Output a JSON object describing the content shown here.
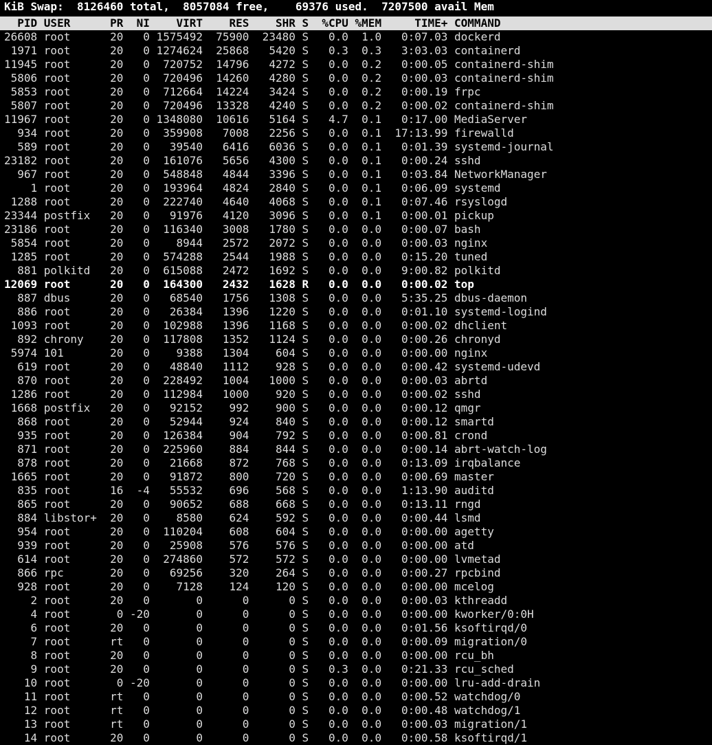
{
  "swap_line_fragment": "KiB Swap:  8126460 total,  8057084 free,    69376 used.  7207500 avail Mem",
  "columns": [
    "PID",
    "USER",
    "PR",
    "NI",
    "VIRT",
    "RES",
    "SHR",
    "S",
    "%CPU",
    "%MEM",
    "TIME+",
    "COMMAND"
  ],
  "processes": [
    {
      "pid": "26608",
      "user": "root",
      "pr": "20",
      "ni": "0",
      "virt": "1575492",
      "res": "75900",
      "shr": "23480",
      "s": "S",
      "cpu": "0.0",
      "mem": "1.0",
      "time": "0:07.03",
      "cmd": "dockerd",
      "bold": false
    },
    {
      "pid": "1971",
      "user": "root",
      "pr": "20",
      "ni": "0",
      "virt": "1274624",
      "res": "25868",
      "shr": "5420",
      "s": "S",
      "cpu": "0.3",
      "mem": "0.3",
      "time": "3:03.03",
      "cmd": "containerd",
      "bold": false
    },
    {
      "pid": "11945",
      "user": "root",
      "pr": "20",
      "ni": "0",
      "virt": "720752",
      "res": "14796",
      "shr": "4272",
      "s": "S",
      "cpu": "0.0",
      "mem": "0.2",
      "time": "0:00.05",
      "cmd": "containerd-shim",
      "bold": false
    },
    {
      "pid": "5806",
      "user": "root",
      "pr": "20",
      "ni": "0",
      "virt": "720496",
      "res": "14260",
      "shr": "4280",
      "s": "S",
      "cpu": "0.0",
      "mem": "0.2",
      "time": "0:00.03",
      "cmd": "containerd-shim",
      "bold": false
    },
    {
      "pid": "5853",
      "user": "root",
      "pr": "20",
      "ni": "0",
      "virt": "712664",
      "res": "14224",
      "shr": "3424",
      "s": "S",
      "cpu": "0.0",
      "mem": "0.2",
      "time": "0:00.19",
      "cmd": "frpc",
      "bold": false
    },
    {
      "pid": "5807",
      "user": "root",
      "pr": "20",
      "ni": "0",
      "virt": "720496",
      "res": "13328",
      "shr": "4240",
      "s": "S",
      "cpu": "0.0",
      "mem": "0.2",
      "time": "0:00.02",
      "cmd": "containerd-shim",
      "bold": false
    },
    {
      "pid": "11967",
      "user": "root",
      "pr": "20",
      "ni": "0",
      "virt": "1348080",
      "res": "10616",
      "shr": "5164",
      "s": "S",
      "cpu": "4.7",
      "mem": "0.1",
      "time": "0:17.00",
      "cmd": "MediaServer",
      "bold": false
    },
    {
      "pid": "934",
      "user": "root",
      "pr": "20",
      "ni": "0",
      "virt": "359908",
      "res": "7008",
      "shr": "2256",
      "s": "S",
      "cpu": "0.0",
      "mem": "0.1",
      "time": "17:13.99",
      "cmd": "firewalld",
      "bold": false
    },
    {
      "pid": "589",
      "user": "root",
      "pr": "20",
      "ni": "0",
      "virt": "39540",
      "res": "6416",
      "shr": "6036",
      "s": "S",
      "cpu": "0.0",
      "mem": "0.1",
      "time": "0:01.39",
      "cmd": "systemd-journal",
      "bold": false
    },
    {
      "pid": "23182",
      "user": "root",
      "pr": "20",
      "ni": "0",
      "virt": "161076",
      "res": "5656",
      "shr": "4300",
      "s": "S",
      "cpu": "0.0",
      "mem": "0.1",
      "time": "0:00.24",
      "cmd": "sshd",
      "bold": false
    },
    {
      "pid": "967",
      "user": "root",
      "pr": "20",
      "ni": "0",
      "virt": "548848",
      "res": "4844",
      "shr": "3396",
      "s": "S",
      "cpu": "0.0",
      "mem": "0.1",
      "time": "0:03.84",
      "cmd": "NetworkManager",
      "bold": false
    },
    {
      "pid": "1",
      "user": "root",
      "pr": "20",
      "ni": "0",
      "virt": "193964",
      "res": "4824",
      "shr": "2840",
      "s": "S",
      "cpu": "0.0",
      "mem": "0.1",
      "time": "0:06.09",
      "cmd": "systemd",
      "bold": false
    },
    {
      "pid": "1288",
      "user": "root",
      "pr": "20",
      "ni": "0",
      "virt": "222740",
      "res": "4640",
      "shr": "4068",
      "s": "S",
      "cpu": "0.0",
      "mem": "0.1",
      "time": "0:07.46",
      "cmd": "rsyslogd",
      "bold": false
    },
    {
      "pid": "23344",
      "user": "postfix",
      "pr": "20",
      "ni": "0",
      "virt": "91976",
      "res": "4120",
      "shr": "3096",
      "s": "S",
      "cpu": "0.0",
      "mem": "0.1",
      "time": "0:00.01",
      "cmd": "pickup",
      "bold": false
    },
    {
      "pid": "23186",
      "user": "root",
      "pr": "20",
      "ni": "0",
      "virt": "116340",
      "res": "3008",
      "shr": "1780",
      "s": "S",
      "cpu": "0.0",
      "mem": "0.0",
      "time": "0:00.07",
      "cmd": "bash",
      "bold": false
    },
    {
      "pid": "5854",
      "user": "root",
      "pr": "20",
      "ni": "0",
      "virt": "8944",
      "res": "2572",
      "shr": "2072",
      "s": "S",
      "cpu": "0.0",
      "mem": "0.0",
      "time": "0:00.03",
      "cmd": "nginx",
      "bold": false
    },
    {
      "pid": "1285",
      "user": "root",
      "pr": "20",
      "ni": "0",
      "virt": "574288",
      "res": "2544",
      "shr": "1988",
      "s": "S",
      "cpu": "0.0",
      "mem": "0.0",
      "time": "0:15.20",
      "cmd": "tuned",
      "bold": false
    },
    {
      "pid": "881",
      "user": "polkitd",
      "pr": "20",
      "ni": "0",
      "virt": "615088",
      "res": "2472",
      "shr": "1692",
      "s": "S",
      "cpu": "0.0",
      "mem": "0.0",
      "time": "9:00.82",
      "cmd": "polkitd",
      "bold": false
    },
    {
      "pid": "12069",
      "user": "root",
      "pr": "20",
      "ni": "0",
      "virt": "164300",
      "res": "2432",
      "shr": "1628",
      "s": "R",
      "cpu": "0.0",
      "mem": "0.0",
      "time": "0:00.02",
      "cmd": "top",
      "bold": true
    },
    {
      "pid": "887",
      "user": "dbus",
      "pr": "20",
      "ni": "0",
      "virt": "68540",
      "res": "1756",
      "shr": "1308",
      "s": "S",
      "cpu": "0.0",
      "mem": "0.0",
      "time": "5:35.25",
      "cmd": "dbus-daemon",
      "bold": false
    },
    {
      "pid": "886",
      "user": "root",
      "pr": "20",
      "ni": "0",
      "virt": "26384",
      "res": "1396",
      "shr": "1220",
      "s": "S",
      "cpu": "0.0",
      "mem": "0.0",
      "time": "0:01.10",
      "cmd": "systemd-logind",
      "bold": false
    },
    {
      "pid": "1093",
      "user": "root",
      "pr": "20",
      "ni": "0",
      "virt": "102988",
      "res": "1396",
      "shr": "1168",
      "s": "S",
      "cpu": "0.0",
      "mem": "0.0",
      "time": "0:00.02",
      "cmd": "dhclient",
      "bold": false
    },
    {
      "pid": "892",
      "user": "chrony",
      "pr": "20",
      "ni": "0",
      "virt": "117808",
      "res": "1352",
      "shr": "1124",
      "s": "S",
      "cpu": "0.0",
      "mem": "0.0",
      "time": "0:00.26",
      "cmd": "chronyd",
      "bold": false
    },
    {
      "pid": "5974",
      "user": "101",
      "pr": "20",
      "ni": "0",
      "virt": "9388",
      "res": "1304",
      "shr": "604",
      "s": "S",
      "cpu": "0.0",
      "mem": "0.0",
      "time": "0:00.00",
      "cmd": "nginx",
      "bold": false
    },
    {
      "pid": "619",
      "user": "root",
      "pr": "20",
      "ni": "0",
      "virt": "48840",
      "res": "1112",
      "shr": "928",
      "s": "S",
      "cpu": "0.0",
      "mem": "0.0",
      "time": "0:00.42",
      "cmd": "systemd-udevd",
      "bold": false
    },
    {
      "pid": "870",
      "user": "root",
      "pr": "20",
      "ni": "0",
      "virt": "228492",
      "res": "1004",
      "shr": "1000",
      "s": "S",
      "cpu": "0.0",
      "mem": "0.0",
      "time": "0:00.03",
      "cmd": "abrtd",
      "bold": false
    },
    {
      "pid": "1286",
      "user": "root",
      "pr": "20",
      "ni": "0",
      "virt": "112984",
      "res": "1000",
      "shr": "920",
      "s": "S",
      "cpu": "0.0",
      "mem": "0.0",
      "time": "0:00.02",
      "cmd": "sshd",
      "bold": false
    },
    {
      "pid": "1668",
      "user": "postfix",
      "pr": "20",
      "ni": "0",
      "virt": "92152",
      "res": "992",
      "shr": "900",
      "s": "S",
      "cpu": "0.0",
      "mem": "0.0",
      "time": "0:00.12",
      "cmd": "qmgr",
      "bold": false
    },
    {
      "pid": "868",
      "user": "root",
      "pr": "20",
      "ni": "0",
      "virt": "52944",
      "res": "924",
      "shr": "840",
      "s": "S",
      "cpu": "0.0",
      "mem": "0.0",
      "time": "0:00.12",
      "cmd": "smartd",
      "bold": false
    },
    {
      "pid": "935",
      "user": "root",
      "pr": "20",
      "ni": "0",
      "virt": "126384",
      "res": "904",
      "shr": "792",
      "s": "S",
      "cpu": "0.0",
      "mem": "0.0",
      "time": "0:00.81",
      "cmd": "crond",
      "bold": false
    },
    {
      "pid": "871",
      "user": "root",
      "pr": "20",
      "ni": "0",
      "virt": "225960",
      "res": "884",
      "shr": "844",
      "s": "S",
      "cpu": "0.0",
      "mem": "0.0",
      "time": "0:00.14",
      "cmd": "abrt-watch-log",
      "bold": false
    },
    {
      "pid": "878",
      "user": "root",
      "pr": "20",
      "ni": "0",
      "virt": "21668",
      "res": "872",
      "shr": "768",
      "s": "S",
      "cpu": "0.0",
      "mem": "0.0",
      "time": "0:13.09",
      "cmd": "irqbalance",
      "bold": false
    },
    {
      "pid": "1665",
      "user": "root",
      "pr": "20",
      "ni": "0",
      "virt": "91872",
      "res": "800",
      "shr": "720",
      "s": "S",
      "cpu": "0.0",
      "mem": "0.0",
      "time": "0:00.69",
      "cmd": "master",
      "bold": false
    },
    {
      "pid": "835",
      "user": "root",
      "pr": "16",
      "ni": "-4",
      "virt": "55532",
      "res": "696",
      "shr": "568",
      "s": "S",
      "cpu": "0.0",
      "mem": "0.0",
      "time": "1:13.90",
      "cmd": "auditd",
      "bold": false
    },
    {
      "pid": "865",
      "user": "root",
      "pr": "20",
      "ni": "0",
      "virt": "90652",
      "res": "688",
      "shr": "668",
      "s": "S",
      "cpu": "0.0",
      "mem": "0.0",
      "time": "0:13.11",
      "cmd": "rngd",
      "bold": false
    },
    {
      "pid": "884",
      "user": "libstor+",
      "pr": "20",
      "ni": "0",
      "virt": "8580",
      "res": "624",
      "shr": "592",
      "s": "S",
      "cpu": "0.0",
      "mem": "0.0",
      "time": "0:00.44",
      "cmd": "lsmd",
      "bold": false
    },
    {
      "pid": "954",
      "user": "root",
      "pr": "20",
      "ni": "0",
      "virt": "110204",
      "res": "608",
      "shr": "604",
      "s": "S",
      "cpu": "0.0",
      "mem": "0.0",
      "time": "0:00.00",
      "cmd": "agetty",
      "bold": false
    },
    {
      "pid": "939",
      "user": "root",
      "pr": "20",
      "ni": "0",
      "virt": "25908",
      "res": "576",
      "shr": "576",
      "s": "S",
      "cpu": "0.0",
      "mem": "0.0",
      "time": "0:00.00",
      "cmd": "atd",
      "bold": false
    },
    {
      "pid": "614",
      "user": "root",
      "pr": "20",
      "ni": "0",
      "virt": "274860",
      "res": "572",
      "shr": "572",
      "s": "S",
      "cpu": "0.0",
      "mem": "0.0",
      "time": "0:00.00",
      "cmd": "lvmetad",
      "bold": false
    },
    {
      "pid": "866",
      "user": "rpc",
      "pr": "20",
      "ni": "0",
      "virt": "69256",
      "res": "320",
      "shr": "264",
      "s": "S",
      "cpu": "0.0",
      "mem": "0.0",
      "time": "0:00.27",
      "cmd": "rpcbind",
      "bold": false
    },
    {
      "pid": "928",
      "user": "root",
      "pr": "20",
      "ni": "0",
      "virt": "7128",
      "res": "124",
      "shr": "120",
      "s": "S",
      "cpu": "0.0",
      "mem": "0.0",
      "time": "0:00.00",
      "cmd": "mcelog",
      "bold": false
    },
    {
      "pid": "2",
      "user": "root",
      "pr": "20",
      "ni": "0",
      "virt": "0",
      "res": "0",
      "shr": "0",
      "s": "S",
      "cpu": "0.0",
      "mem": "0.0",
      "time": "0:00.03",
      "cmd": "kthreadd",
      "bold": false
    },
    {
      "pid": "4",
      "user": "root",
      "pr": "0",
      "ni": "-20",
      "virt": "0",
      "res": "0",
      "shr": "0",
      "s": "S",
      "cpu": "0.0",
      "mem": "0.0",
      "time": "0:00.00",
      "cmd": "kworker/0:0H",
      "bold": false
    },
    {
      "pid": "6",
      "user": "root",
      "pr": "20",
      "ni": "0",
      "virt": "0",
      "res": "0",
      "shr": "0",
      "s": "S",
      "cpu": "0.0",
      "mem": "0.0",
      "time": "0:01.56",
      "cmd": "ksoftirqd/0",
      "bold": false
    },
    {
      "pid": "7",
      "user": "root",
      "pr": "rt",
      "ni": "0",
      "virt": "0",
      "res": "0",
      "shr": "0",
      "s": "S",
      "cpu": "0.0",
      "mem": "0.0",
      "time": "0:00.09",
      "cmd": "migration/0",
      "bold": false
    },
    {
      "pid": "8",
      "user": "root",
      "pr": "20",
      "ni": "0",
      "virt": "0",
      "res": "0",
      "shr": "0",
      "s": "S",
      "cpu": "0.0",
      "mem": "0.0",
      "time": "0:00.00",
      "cmd": "rcu_bh",
      "bold": false
    },
    {
      "pid": "9",
      "user": "root",
      "pr": "20",
      "ni": "0",
      "virt": "0",
      "res": "0",
      "shr": "0",
      "s": "S",
      "cpu": "0.3",
      "mem": "0.0",
      "time": "0:21.33",
      "cmd": "rcu_sched",
      "bold": false
    },
    {
      "pid": "10",
      "user": "root",
      "pr": "0",
      "ni": "-20",
      "virt": "0",
      "res": "0",
      "shr": "0",
      "s": "S",
      "cpu": "0.0",
      "mem": "0.0",
      "time": "0:00.00",
      "cmd": "lru-add-drain",
      "bold": false
    },
    {
      "pid": "11",
      "user": "root",
      "pr": "rt",
      "ni": "0",
      "virt": "0",
      "res": "0",
      "shr": "0",
      "s": "S",
      "cpu": "0.0",
      "mem": "0.0",
      "time": "0:00.52",
      "cmd": "watchdog/0",
      "bold": false
    },
    {
      "pid": "12",
      "user": "root",
      "pr": "rt",
      "ni": "0",
      "virt": "0",
      "res": "0",
      "shr": "0",
      "s": "S",
      "cpu": "0.0",
      "mem": "0.0",
      "time": "0:00.48",
      "cmd": "watchdog/1",
      "bold": false
    },
    {
      "pid": "13",
      "user": "root",
      "pr": "rt",
      "ni": "0",
      "virt": "0",
      "res": "0",
      "shr": "0",
      "s": "S",
      "cpu": "0.0",
      "mem": "0.0",
      "time": "0:00.03",
      "cmd": "migration/1",
      "bold": false
    },
    {
      "pid": "14",
      "user": "root",
      "pr": "20",
      "ni": "0",
      "virt": "0",
      "res": "0",
      "shr": "0",
      "s": "S",
      "cpu": "0.0",
      "mem": "0.0",
      "time": "0:00.58",
      "cmd": "ksoftirqd/1",
      "bold": false
    }
  ]
}
